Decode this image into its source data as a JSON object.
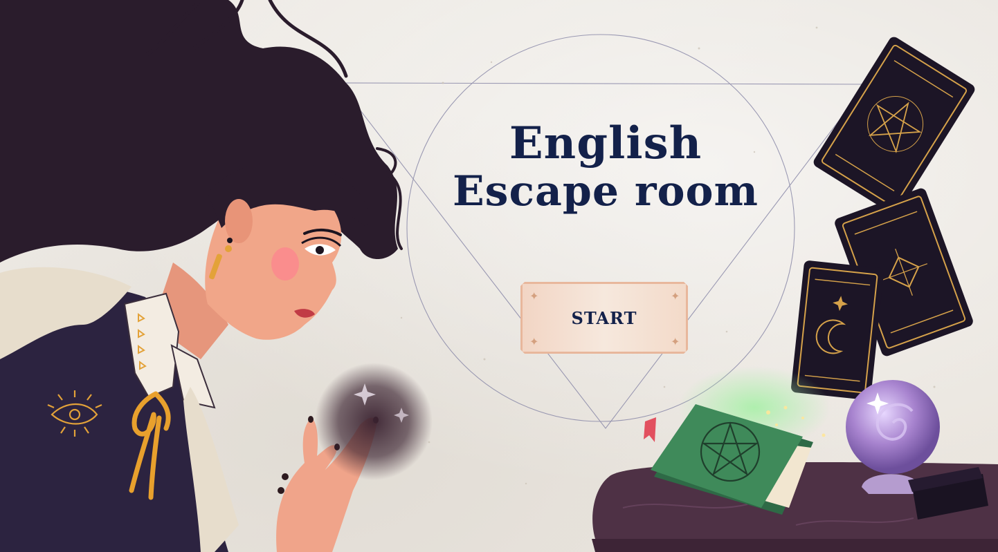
{
  "title": {
    "line1": "English",
    "line2": "Escape room"
  },
  "start_button": {
    "label": "START"
  },
  "colors": {
    "title": "#13214a",
    "button_fill": "#f4e2d6",
    "button_border": "#e8b79c",
    "hair": "#2a1c2c",
    "vest": "#2c2340",
    "skin": "#f0a48a",
    "card": "#1c1526",
    "card_gold": "#d6a24a",
    "book": "#3f8a5a",
    "orb": "#a884cf",
    "table": "#4e3145"
  },
  "icons": [
    "eye-pin-icon",
    "pentagram-icon",
    "moon-icon",
    "sparkle-icon",
    "star-icon"
  ]
}
